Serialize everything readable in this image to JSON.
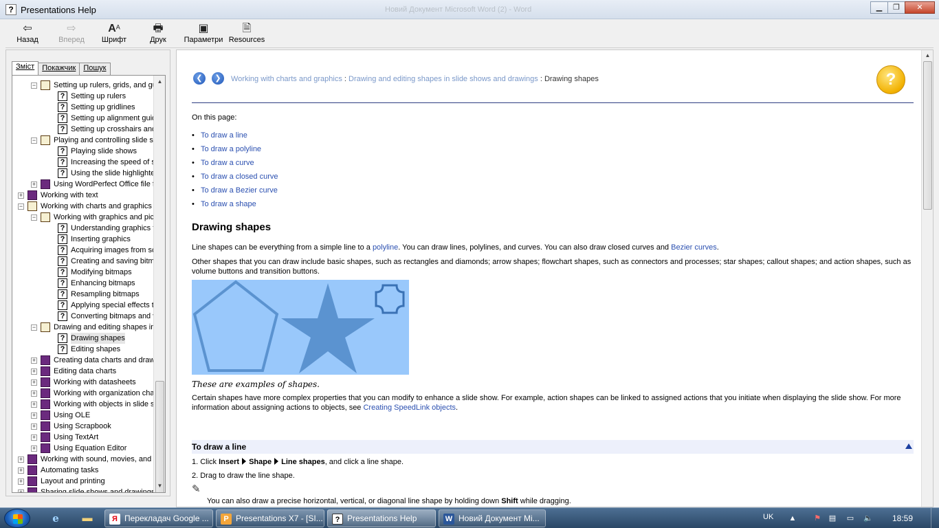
{
  "window": {
    "title": "Presentations Help",
    "background_title": "Новий Документ Microsoft Word (2) - Word"
  },
  "toolbar": {
    "back": "Назад",
    "forward": "Вперед",
    "font": "Шрифт",
    "print": "Друк",
    "options": "Параметри",
    "resources": "Resources"
  },
  "tabs": {
    "contents": "Зміст",
    "index": "Покажчик",
    "search": "Пошук"
  },
  "tree": [
    {
      "label": "Setting up rulers, grids, and guidelines",
      "level": 2,
      "type": "book-open",
      "toggle": "−"
    },
    {
      "label": "Setting up rulers",
      "level": 3,
      "type": "help"
    },
    {
      "label": "Setting up gridlines",
      "level": 3,
      "type": "help"
    },
    {
      "label": "Setting up alignment guidelines",
      "level": 3,
      "type": "help"
    },
    {
      "label": "Setting up crosshairs and the",
      "level": 3,
      "type": "help"
    },
    {
      "label": "Playing and controlling slide shows",
      "level": 2,
      "type": "book-open",
      "toggle": "−"
    },
    {
      "label": "Playing slide shows",
      "level": 3,
      "type": "help"
    },
    {
      "label": "Increasing the speed of slide shows",
      "level": 3,
      "type": "help"
    },
    {
      "label": "Using the slide highlighter",
      "level": 3,
      "type": "help"
    },
    {
      "label": "Using WordPerfect Office file formats",
      "level": 2,
      "type": "book",
      "toggle": "+"
    },
    {
      "label": "Working with text",
      "level": 1,
      "type": "book",
      "toggle": "+"
    },
    {
      "label": "Working with charts and graphics",
      "level": 1,
      "type": "book-open",
      "toggle": "−"
    },
    {
      "label": "Working with graphics and pictures",
      "level": 2,
      "type": "book-open",
      "toggle": "−"
    },
    {
      "label": "Understanding graphics formats",
      "level": 3,
      "type": "help"
    },
    {
      "label": "Inserting graphics",
      "level": 3,
      "type": "help"
    },
    {
      "label": "Acquiring images from scanners",
      "level": 3,
      "type": "help"
    },
    {
      "label": "Creating and saving bitmaps",
      "level": 3,
      "type": "help"
    },
    {
      "label": "Modifying bitmaps",
      "level": 3,
      "type": "help"
    },
    {
      "label": "Enhancing bitmaps",
      "level": 3,
      "type": "help"
    },
    {
      "label": "Resampling bitmaps",
      "level": 3,
      "type": "help"
    },
    {
      "label": "Applying special effects to bitmaps",
      "level": 3,
      "type": "help"
    },
    {
      "label": "Converting bitmaps and vectors",
      "level": 3,
      "type": "help"
    },
    {
      "label": "Drawing and editing shapes in slide shows",
      "level": 2,
      "type": "book-open",
      "toggle": "−"
    },
    {
      "label": "Drawing shapes",
      "level": 3,
      "type": "help",
      "selected": true
    },
    {
      "label": "Editing shapes",
      "level": 3,
      "type": "help"
    },
    {
      "label": "Creating data charts and drawings",
      "level": 2,
      "type": "book",
      "toggle": "+"
    },
    {
      "label": "Editing data charts",
      "level": 2,
      "type": "book",
      "toggle": "+"
    },
    {
      "label": "Working with datasheets",
      "level": 2,
      "type": "book",
      "toggle": "+"
    },
    {
      "label": "Working with organization charts",
      "level": 2,
      "type": "book",
      "toggle": "+"
    },
    {
      "label": "Working with objects in slide shows",
      "level": 2,
      "type": "book",
      "toggle": "+"
    },
    {
      "label": "Using OLE",
      "level": 2,
      "type": "book",
      "toggle": "+"
    },
    {
      "label": "Using Scrapbook",
      "level": 2,
      "type": "book",
      "toggle": "+"
    },
    {
      "label": "Using TextArt",
      "level": 2,
      "type": "book",
      "toggle": "+"
    },
    {
      "label": "Using Equation Editor",
      "level": 2,
      "type": "book",
      "toggle": "+"
    },
    {
      "label": "Working with sound, movies, and",
      "level": 1,
      "type": "book",
      "toggle": "+"
    },
    {
      "label": "Automating tasks",
      "level": 1,
      "type": "book",
      "toggle": "+"
    },
    {
      "label": "Layout and printing",
      "level": 1,
      "type": "book",
      "toggle": "+"
    },
    {
      "label": "Sharing slide shows and drawings",
      "level": 1,
      "type": "book",
      "toggle": "+"
    }
  ],
  "content": {
    "breadcrumb": {
      "link1": "Working with charts and graphics",
      "sep": " : ",
      "link2": "Drawing and editing shapes in slide shows and drawings",
      "current": "Drawing shapes"
    },
    "on_this_page": "On this page:",
    "toc": [
      "To draw a line",
      "To draw a polyline",
      "To draw a curve",
      "To draw a closed curve",
      "To draw a Bezier curve",
      "To draw a shape"
    ],
    "heading": "Drawing shapes",
    "p1_a": "Line shapes can be everything from a simple line to a ",
    "p1_link1": "polyline",
    "p1_b": ". You can draw lines, polylines, and curves. You can also draw closed curves and ",
    "p1_link2": "Bezier curves",
    "p1_c": ".",
    "p2": "Other shapes that you can draw include basic shapes, such as rectangles and diamonds; arrow shapes; flowchart shapes, such as connectors and processes; star shapes; callout shapes; and action shapes, such as volume buttons and transition buttons.",
    "caption": "These are examples of shapes.",
    "p3_a": "Certain shapes have more complex properties that you can modify to enhance a slide show. For example, action shapes can be linked to assigned actions that you initiate when displaying the slide show. For more information about assigning actions to objects, see ",
    "p3_link": "Creating SpeedLink objects",
    "p3_b": ".",
    "sub1": "To draw a line",
    "step1_num": "1. Click ",
    "step1_insert": "Insert",
    "step1_shape": "Shape",
    "step1_line": "Line shapes",
    "step1_rest": ", and click a line shape.",
    "step2": "2. Drag to draw the line shape.",
    "tip_a": "You can also draw a precise horizontal, vertical, or diagonal line shape by holding down ",
    "tip_b": "Shift",
    "tip_c": " while dragging."
  },
  "taskbar": {
    "tasks": [
      "Перекладач Google ...",
      "Presentations X7 - [SI...",
      "Presentations Help",
      "Новий Документ Mi..."
    ],
    "lang": "UK",
    "clock": "18:59"
  },
  "colors": {
    "link": "#2a4fb0",
    "breadcrumb_link": "#7a98c9",
    "shapes_bg": "#99c8fb",
    "shapes_fg": "#5b93d0",
    "rule": "#2c3c80"
  }
}
